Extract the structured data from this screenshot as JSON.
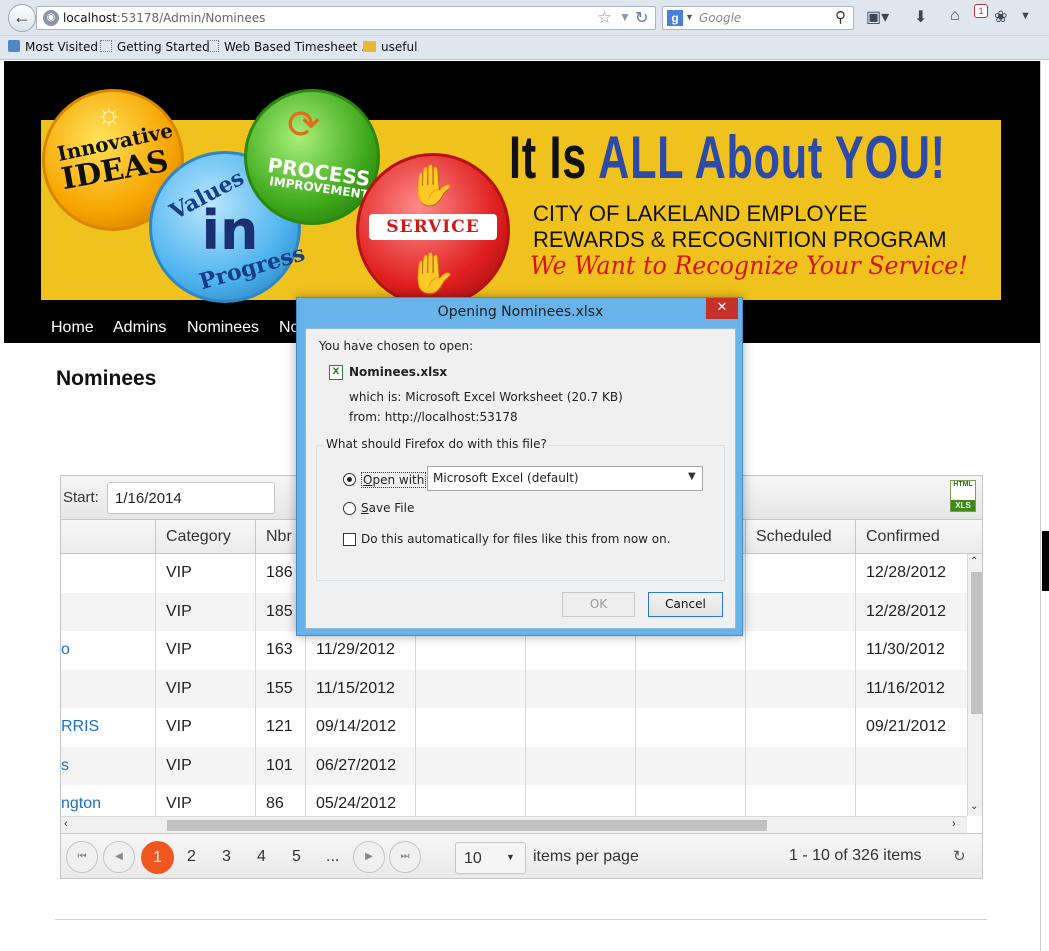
{
  "browser": {
    "url_host": "localhost",
    "url_rest": ":53178/Admin/Nominees",
    "search_placeholder": "Google",
    "notification_count": "1",
    "bookmarks": [
      "Most Visited",
      "Getting Started",
      "Web Based Timesheet ...",
      "useful"
    ]
  },
  "banner": {
    "badge_ideas_line1": "Innovative",
    "badge_ideas_line2": "IDEAS",
    "badge_values_line1": "Values",
    "badge_values_line2": "in",
    "badge_values_line3": "Progress",
    "badge_process_line1": "PROCESS",
    "badge_process_line2": "IMPROVEMENT",
    "badge_service": "SERVICE",
    "headline_part1": "It Is ",
    "headline_part2": "ALL About YOU!",
    "program_line1": "CITY OF LAKELAND EMPLOYEE",
    "program_line2": "REWARDS & RECOGNITION PROGRAM",
    "tagline": "We Want to Recognize Your Service!"
  },
  "nav": {
    "items": [
      "Home",
      "Admins",
      "Nominees",
      "No"
    ]
  },
  "page": {
    "title": "Nominees"
  },
  "grid": {
    "start_label": "Start:",
    "start_value": "1/16/2014",
    "export_icon_top": "HTML",
    "export_icon_bottom": "XLS",
    "columns": [
      "Category",
      "Nbr",
      "Scheduled",
      "Confirmed"
    ],
    "rows": [
      {
        "name": "",
        "category": "VIP",
        "nbr": "186",
        "date": "",
        "confirmed": "12/28/2012"
      },
      {
        "name": "",
        "category": "VIP",
        "nbr": "185",
        "date": "",
        "confirmed": "12/28/2012"
      },
      {
        "name": "o",
        "category": "VIP",
        "nbr": "163",
        "date": "11/29/2012",
        "confirmed": "11/30/2012"
      },
      {
        "name": "",
        "category": "VIP",
        "nbr": "155",
        "date": "11/15/2012",
        "confirmed": "11/16/2012"
      },
      {
        "name": "RRIS",
        "category": "VIP",
        "nbr": "121",
        "date": "09/14/2012",
        "confirmed": "09/21/2012"
      },
      {
        "name": "s",
        "category": "VIP",
        "nbr": "101",
        "date": "06/27/2012",
        "confirmed": ""
      },
      {
        "name": "ngton",
        "category": "VIP",
        "nbr": "86",
        "date": "05/24/2012",
        "confirmed": ""
      }
    ],
    "pager": {
      "current": "1",
      "pages": [
        "2",
        "3",
        "4",
        "5",
        "..."
      ],
      "page_size": "10",
      "items_label": "items per page",
      "info": "1 - 10 of 326 items"
    }
  },
  "dialog": {
    "title": "Opening Nominees.xlsx",
    "chosen_label": "You have chosen to open:",
    "file_name": "Nominees.xlsx",
    "which_is": "which is:  Microsoft Excel Worksheet (20.7 KB)",
    "from": "from:  http://localhost:53178",
    "group_label": "What should Firefox do with this file?",
    "open_with_label": "Open with",
    "open_with_app": "Microsoft Excel (default)",
    "save_label": "Save File",
    "auto_label": "Do this automatically for files like this from now on.",
    "ok_label": "OK",
    "cancel_label": "Cancel"
  }
}
